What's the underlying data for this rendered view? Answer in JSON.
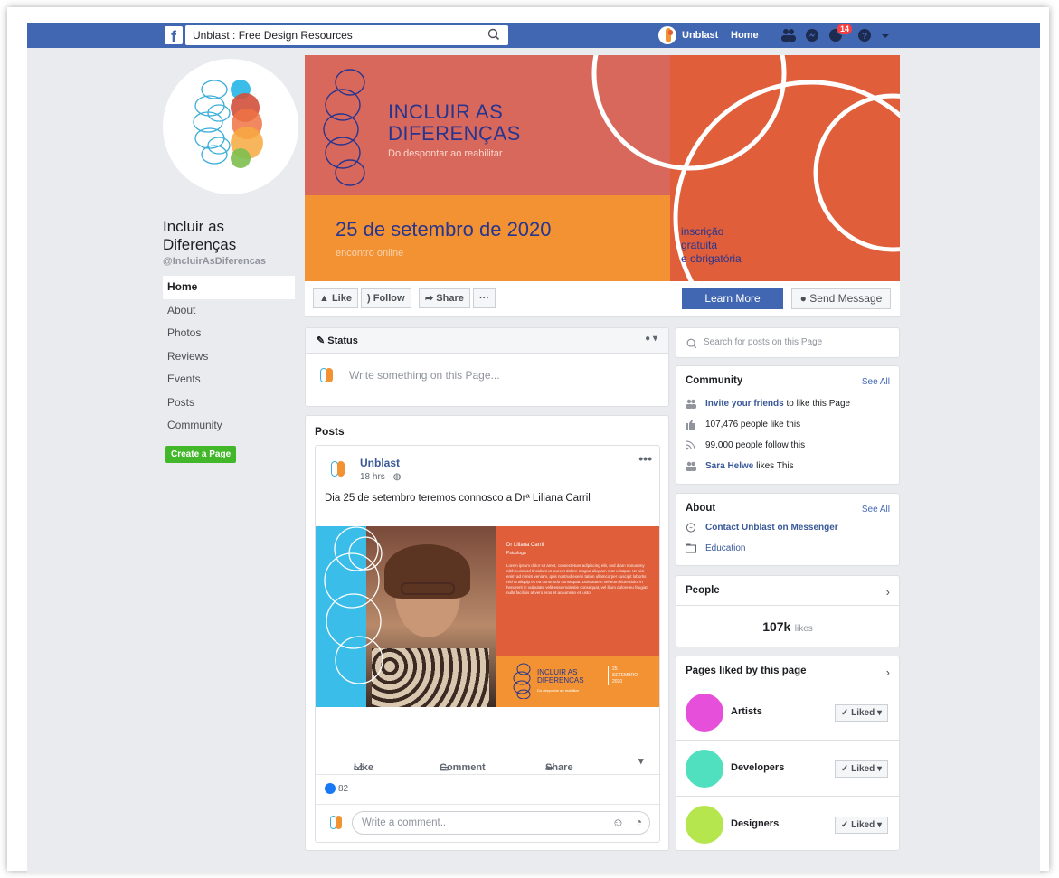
{
  "topbar": {
    "search_value": "Unblast : Free Design Resources",
    "user_name": "Unblast",
    "home_label": "Home",
    "notification_count": "14"
  },
  "page": {
    "name": "Incluir as Diferenças",
    "handle": "@IncluirAsDiferencas"
  },
  "nav": {
    "items": [
      "Home",
      "About",
      "Photos",
      "Reviews",
      "Events",
      "Posts",
      "Community"
    ],
    "create_page": "Create a Page"
  },
  "cover": {
    "title_line1": "INCLUIR AS",
    "title_line2": "DIFERENÇAS",
    "subtitle": "Do despontar ao reabilitar",
    "date": "25 de setembro de 2020",
    "online": "encontro online",
    "insc1": "inscrição",
    "insc2": "gratuita",
    "insc3": "e obrigatória"
  },
  "actions": {
    "like": "Like",
    "follow": "Follow",
    "share": "Share",
    "more": "···",
    "learn_more": "Learn More",
    "send_message": "Send Message"
  },
  "status": {
    "header": "Status",
    "placeholder": "Write something on this Page..."
  },
  "posts": {
    "title": "Posts",
    "author": "Unblast",
    "time": "18 hrs",
    "text": "Dia 25 de setembro teremos connosco a Drª Liliana Carril",
    "image_name": "Dr Liliana Carril",
    "image_role": "Psicologa",
    "image_lorem": "Lorem ipsum dolor sit amet, consectetuer adipiscing elit, sed diam nonummy nibh euismod tincidunt ut laoreet dolore magna aliquam erat volutpat. Ut wisi enim ad minim veniam, quis nostrud exerci tation ullamcorper suscipit lobortis nisl ut aliquip ex ea commodo consequat. Duis autem vel eum iriure dolor in hendrerit in vulputate velit esse molestie consequat, vel illum dolore eu feugiat nulla facilisis at vero eros et accumsan et iusto",
    "image_title1": "INCLUIR AS",
    "image_title2": "DIFERENÇAS",
    "image_sub": "Do despontar ao reabilitar",
    "image_date1": "25",
    "image_date2": "SETEMBRO",
    "image_date3": "2020",
    "like": "Like",
    "comment": "Comment",
    "share": "Share",
    "likes_count": "82",
    "comment_placeholder": "Write a comment.."
  },
  "right": {
    "search_placeholder": "Search for posts on this Page",
    "community_title": "Community",
    "see_all": "See All",
    "invite_link": "Invite your friends",
    "invite_rest": " to like this Page",
    "likes_text": "107,476 people like this",
    "follow_text": "99,000 people follow this",
    "friend_name": "Sara Helwe",
    "friend_rest": " likes This",
    "about_title": "About",
    "about_messenger": "Contact Unblast on Messenger",
    "about_category": "Education",
    "people_title": "People",
    "people_count": "107k",
    "people_unit": "likes",
    "pages_liked_title": "Pages liked by this page",
    "liked_pages": [
      {
        "name": "Artists",
        "color": "#e54fd9"
      },
      {
        "name": "Developers",
        "color": "#51e0bf"
      },
      {
        "name": "Designers",
        "color": "#b5e64e"
      }
    ],
    "liked_label": "✓ Liked ▾"
  }
}
